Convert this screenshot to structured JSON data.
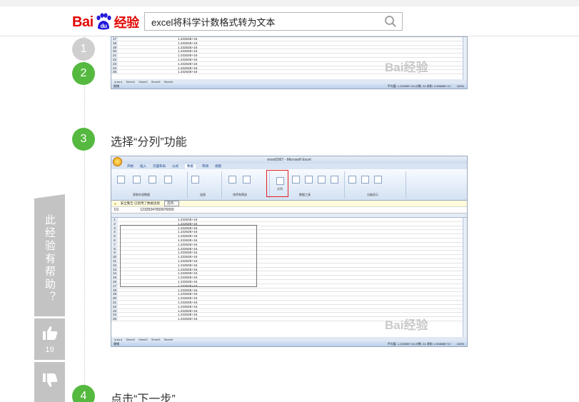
{
  "header": {
    "logo_text": "Bai",
    "logo_suffix": "du",
    "logo_tail": "经验",
    "search_value": "excel将科学计数格式转为文本",
    "search_icon": "search-icon"
  },
  "steps": [
    {
      "num": "1",
      "state": "done"
    },
    {
      "num": "2",
      "state": "active"
    },
    {
      "num": "3",
      "state": "active",
      "title": "选择“分列”功能"
    },
    {
      "num": "4",
      "state": "active",
      "title": "点击“下一步”"
    }
  ],
  "vote": {
    "ask_text": "此经验有帮助？",
    "up_icon": "thumbs-up-icon",
    "up_count": "19",
    "down_icon": "thumbs-down-icon"
  },
  "excel_top": {
    "cell_value": "1.23253E+16",
    "row_numbers": [
      "17",
      "18",
      "19",
      "20",
      "21",
      "22",
      "23",
      "24",
      "25"
    ],
    "sheet_tabs": [
      "Sheet1",
      "Sheet2",
      "Sheet3",
      "Sheet4"
    ],
    "status_left": "就绪",
    "status_mid": "平均值: 1.23253E+16   计数: 24   求和: 2.95808E+17",
    "zoom": "100%",
    "watermark": "Bai经验"
  },
  "excel_main": {
    "window_title": "excel2007 - Microsoft Excel",
    "ribbon_tabs": [
      "开始",
      "插入",
      "页面布局",
      "公式",
      "数据",
      "审阅",
      "视图"
    ],
    "active_tab": "数据",
    "ribbon_groups": [
      "获取外部数据",
      "连接",
      "排序和筛选",
      "数据工具",
      "分级显示"
    ],
    "split_button_label": "分列",
    "security_text": "安全警告   已禁用了数据连接",
    "security_btn": "选项...",
    "name_box": "D1",
    "formula_value": "12325347659976500",
    "cell_value": "1.23253E+16",
    "row_numbers": [
      "1",
      "2",
      "3",
      "4",
      "5",
      "6",
      "7",
      "8",
      "9",
      "10",
      "11",
      "12",
      "13",
      "14",
      "15",
      "16",
      "17",
      "18",
      "19",
      "20",
      "21",
      "22",
      "23",
      "24",
      "25"
    ],
    "sheet_tabs": [
      "Sheet1",
      "Sheet2",
      "Sheet3",
      "Sheet4"
    ],
    "status_left": "就绪",
    "status_mid": "平均值: 1.23253E+16   计数: 24   求和: 2.95808E+17",
    "zoom": "100%",
    "watermark": "Bai经验"
  }
}
